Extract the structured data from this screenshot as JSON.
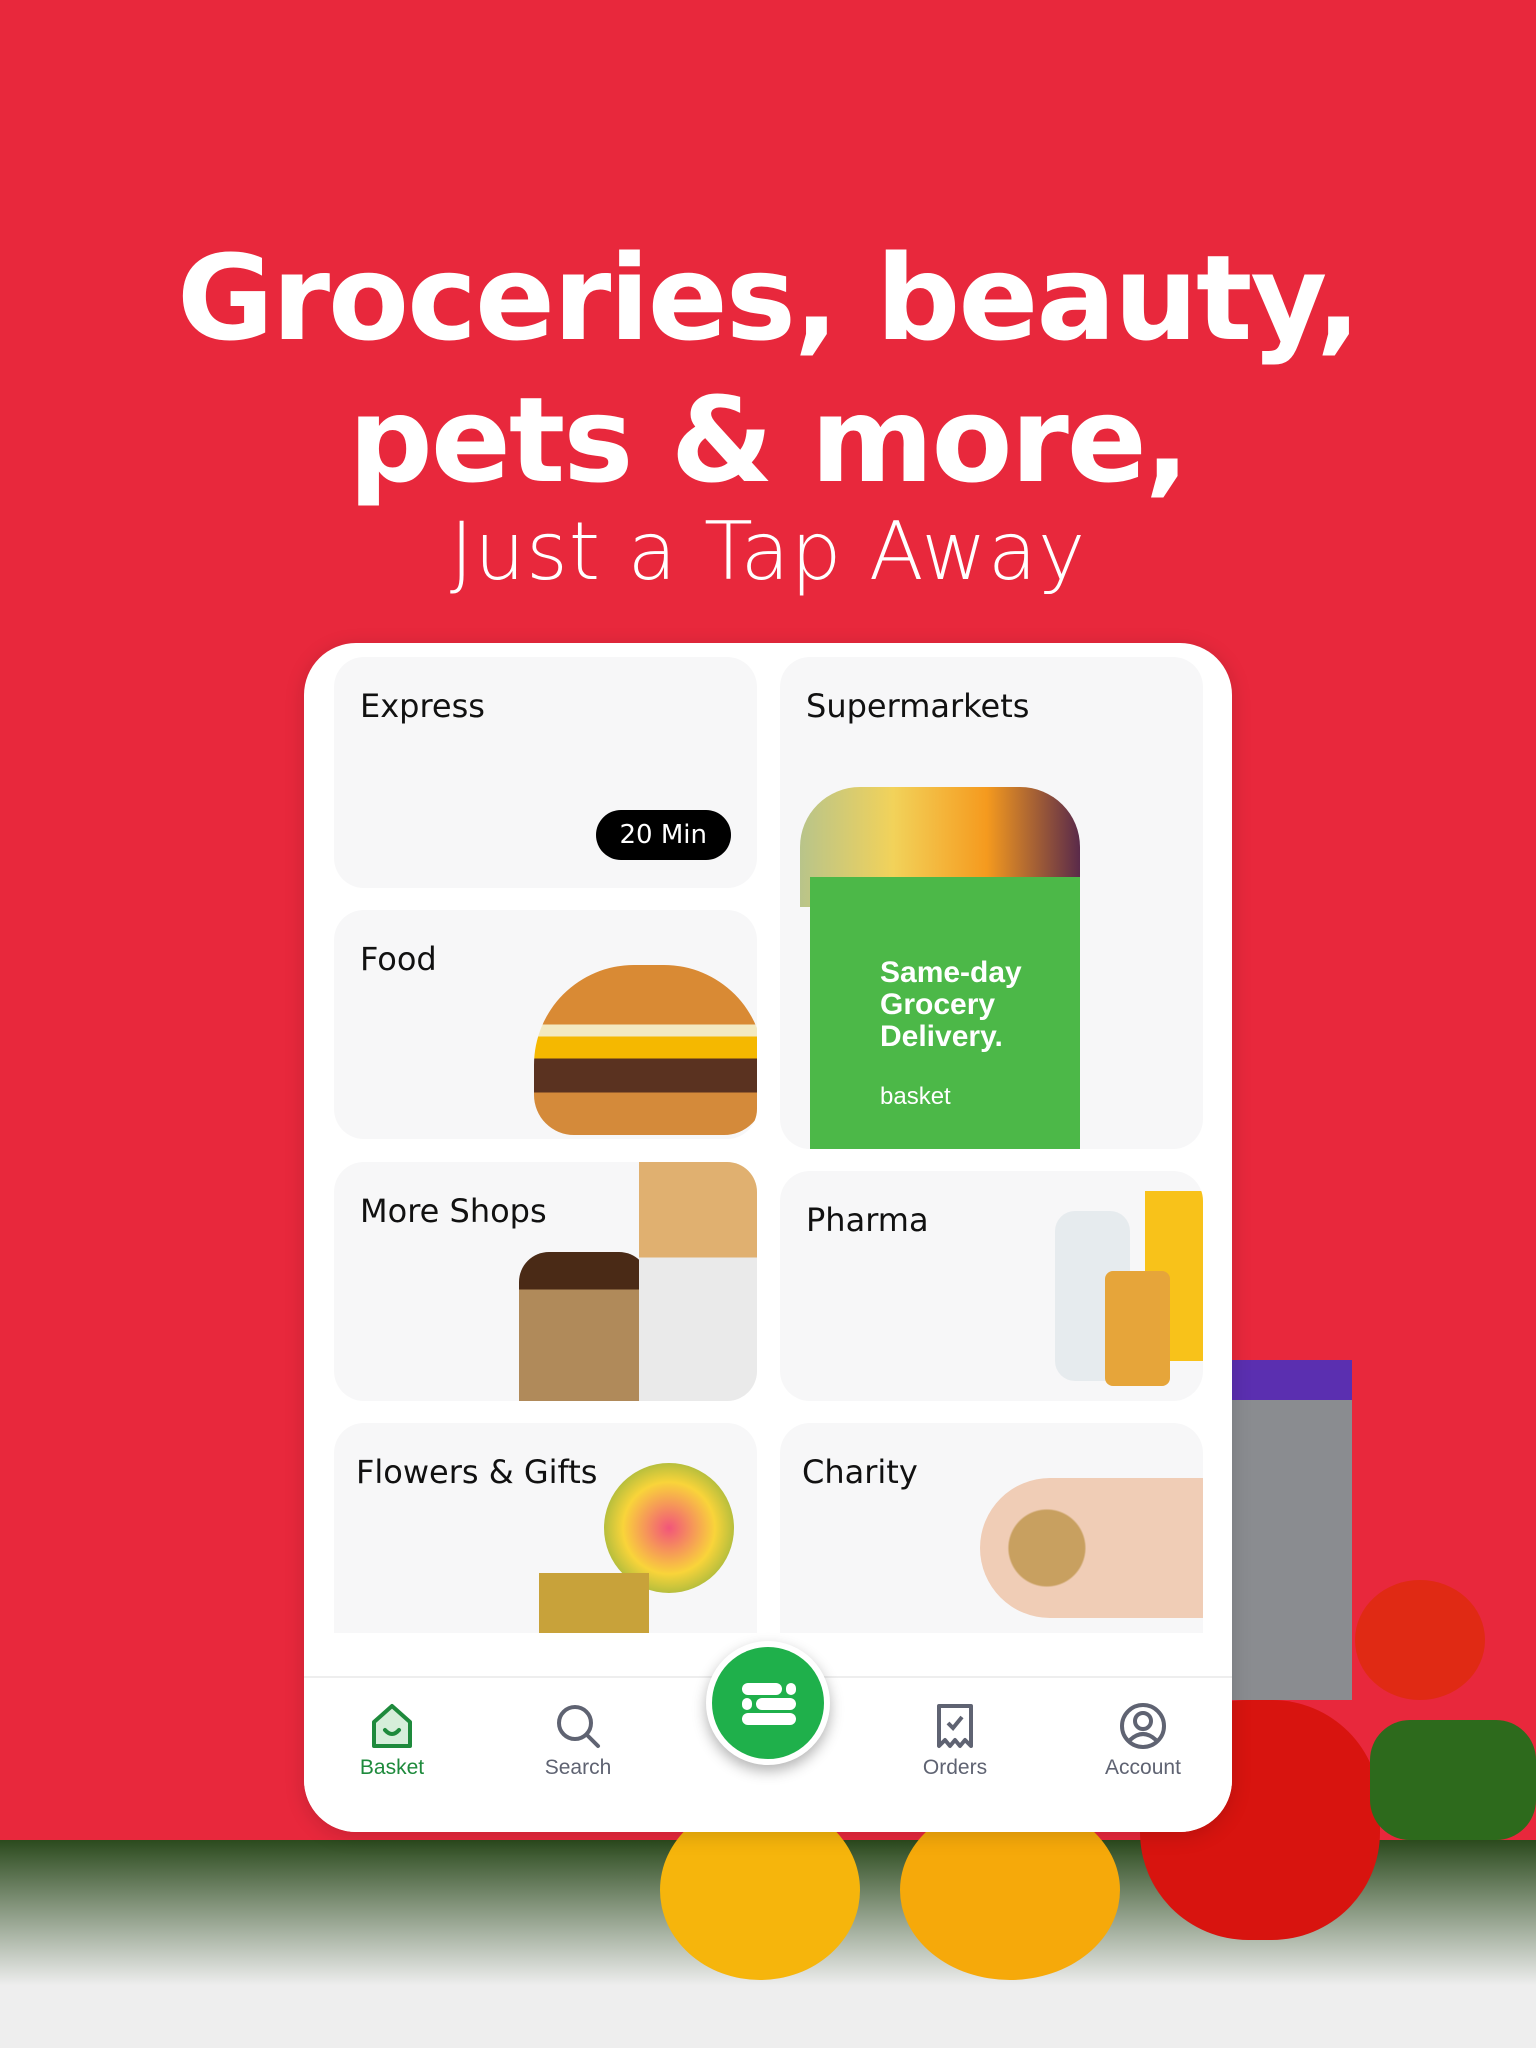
{
  "headline": {
    "line1": "Groceries, beauty,",
    "line2": "pets & more,",
    "subtitle": "Just a Tap Away"
  },
  "tiles": [
    {
      "label": "Express",
      "badge": "20 Min"
    },
    {
      "label": "Supermarkets",
      "bag_text": "Same-day Grocery Delivery.",
      "bag_logo": "basket"
    },
    {
      "label": "Food"
    },
    {
      "label": "More Shops"
    },
    {
      "label": "Pharma"
    },
    {
      "label": "Flowers & Gifts"
    },
    {
      "label": "Charity"
    }
  ],
  "nav": {
    "items": [
      {
        "label": "Basket",
        "icon": "home-icon",
        "active": true
      },
      {
        "label": "Search",
        "icon": "search-icon"
      },
      {
        "label": "Orders",
        "icon": "receipt-icon"
      },
      {
        "label": "Account",
        "icon": "account-icon"
      }
    ],
    "center_icon": "menu-icon"
  },
  "colors": {
    "background": "#e8283c",
    "accent": "#1fb04b",
    "active_nav": "#1e8a3c"
  }
}
